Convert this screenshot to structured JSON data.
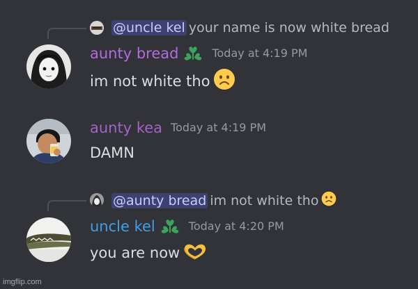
{
  "colors": {
    "background": "#313338",
    "mention": "#c9cdfb",
    "mention_bg": "rgba(88,101,242,0.3)",
    "aunty_bread": "#b36be0",
    "aunty_kea": "#a463c9",
    "uncle_kel": "#3ea0e6",
    "badge": "#3ba55c",
    "timestamp": "#949ba4"
  },
  "messages": [
    {
      "reply": {
        "mention": "@uncle kel",
        "text": "your name is now white bread"
      },
      "author": "aunty bread",
      "timestamp": "Today at 4:19 PM",
      "content": "im not white tho",
      "emoji": "frowning-face-icon"
    },
    {
      "author": "aunty kea",
      "timestamp": "Today at 4:19 PM",
      "content": "DAMN"
    },
    {
      "reply": {
        "mention": "@aunty bread",
        "text": "im not white tho"
      },
      "author": "uncle kel",
      "timestamp": "Today at 4:20 PM",
      "content": "you are now",
      "emoji": "heart-hands-icon"
    }
  ],
  "watermark": "imgflip.com"
}
